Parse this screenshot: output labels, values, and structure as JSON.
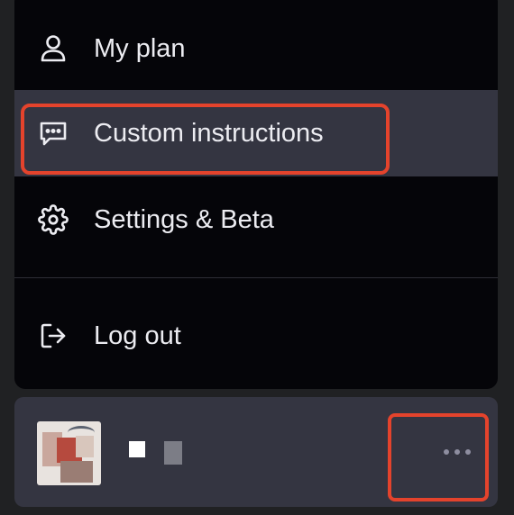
{
  "menu": {
    "items": [
      {
        "label": "My plan",
        "icon": "user-icon"
      },
      {
        "label": "Custom instructions",
        "icon": "message-dots-icon"
      },
      {
        "label": "Settings & Beta",
        "icon": "gear-icon"
      },
      {
        "label": "Log out",
        "icon": "logout-icon"
      }
    ],
    "active_index": 1
  },
  "account": {
    "more_icon": "more-horizontal-icon"
  },
  "colors": {
    "menu_bg": "#050509",
    "active_bg": "#343541",
    "text": "#ececf1",
    "highlight": "#e4432c"
  }
}
